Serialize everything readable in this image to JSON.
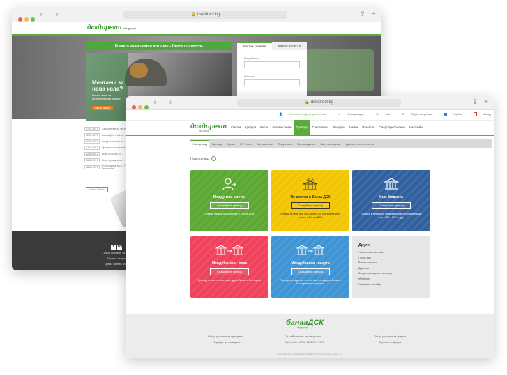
{
  "back_window": {
    "url": "dskdirect.bg",
    "logo": "дскдирект",
    "logo_sub": "otp group",
    "banner": "Бъдете защитени в интернет. Научете повече.",
    "hero": {
      "title": "Мечтаеш за нова кола?",
      "subtitle": "Вземи заем за потребителски кредит",
      "button": "Научи повече"
    },
    "login": {
      "tabs": [
        "Частни клиенти",
        "Бизнес клиенти"
      ],
      "username_label": "Потребител",
      "password_label": "Парола"
    },
    "news": [
      {
        "date": "27.11.2017",
        "text": "Задължение за честно..."
      },
      {
        "date": "22.11.2017",
        "text": "Банка ДСК е банка..."
      },
      {
        "date": "17.10.2017",
        "text": "Свидетелството за..."
      },
      {
        "date": "07.10.2017",
        "text": "Промени в правилата..."
      },
      {
        "date": "02.09.2017",
        "text": "Нови условия, ст..."
      },
      {
        "date": "26.08.2017",
        "text": "Нова функционал..."
      },
      {
        "date": "18.08.2017",
        "text": "Представяне на н... Пакет Запознайте..."
      }
    ],
    "all_news": "Всички Новини",
    "social": [
      "f",
      "You"
    ],
    "footer_links": [
      "Общи условия за гражданите",
      "Тарифа за граждани",
      "Девиз финии за граждани"
    ]
  },
  "front_window": {
    "url": "dskdirect.bg",
    "topbar": {
      "user": "Константин Димитров Колев",
      "items": [
        "Информация",
        "Чат",
        "Обратна връзка",
        "English",
        "Изход"
      ]
    },
    "logo": "дскдирект",
    "logo_sub": "otp group",
    "menu": [
      "Сметки",
      "Кредити",
      "Карти",
      "Битови сметки",
      "Преводи",
      "Спестяване",
      "Фондове",
      "Заявки",
      "Известия",
      "Смарт приложения",
      "Настройки"
    ],
    "menu_active_index": 4,
    "subnav": [
      "Нов превод",
      "Преводи",
      "Архив",
      "PIP Transf",
      "Автоматични",
      "Получатели",
      "Потвърждения",
      "Валутни курсове",
      "Документ на съответни"
    ],
    "subnav_active_index": 0,
    "page_title": "Нов превод",
    "tiles": {
      "own": {
        "title": "Между мои сметки",
        "button": "Създай нов превод",
        "desc": "Превод между свои сметки в Банка ДСК."
      },
      "dsk": {
        "title": "По сметка в Банка ДСК",
        "button": "Създай нов превод",
        "desc": "Превод в лева или във валута по сметка на друг клиент в Банка ДСК."
      },
      "budget": {
        "title": "Към бюджета",
        "button": "Създай нов превод",
        "desc": "Превод в лева към бюджетни сметки (за преводи към НАП, НОИ и др)."
      },
      "bgn": {
        "title": "Междубанков - лева",
        "button": "Създай нов превод",
        "desc": "Превод в лева по сметка в друга банка в България."
      },
      "fx": {
        "title": "Междубанков - валута",
        "button": "Създай нов превод",
        "desc": "Превод в чужда валута по сметка в друга банка в България или чужбина."
      }
    },
    "others": {
      "title": "Други",
      "links": [
        "Нематериални такси",
        "Глоби КАТ",
        "Вот на нитекст",
        "Дарения",
        "За доставчици на търговци",
        "еPlatform",
        "Плащане на сейф"
      ]
    },
    "footer": {
      "logo": "банкаДСК",
      "logo_sub": "otp group",
      "col_left": [
        "Общи условия за граждани",
        "Тарифа за граждани"
      ],
      "col_mid": [
        "По-ребителско ръководство",
        "Call center: 0700 10 375 / *2375"
      ],
      "col_right": [
        "Общи условия за фирми",
        "Тарифа за фирми"
      ],
      "copyright": "ИНТЕРНЕТ БАНКИРАНЕ DSKDIRECT © 2019 БАНКА ДСК ЕАД"
    }
  },
  "colors": {
    "accent_green": "#5aab37",
    "tile_green": "#5aa731",
    "tile_yellow": "#f2c500",
    "tile_blue_dark": "#2f5f9e",
    "tile_red": "#f0405a",
    "tile_blue_light": "#3d93d3"
  }
}
